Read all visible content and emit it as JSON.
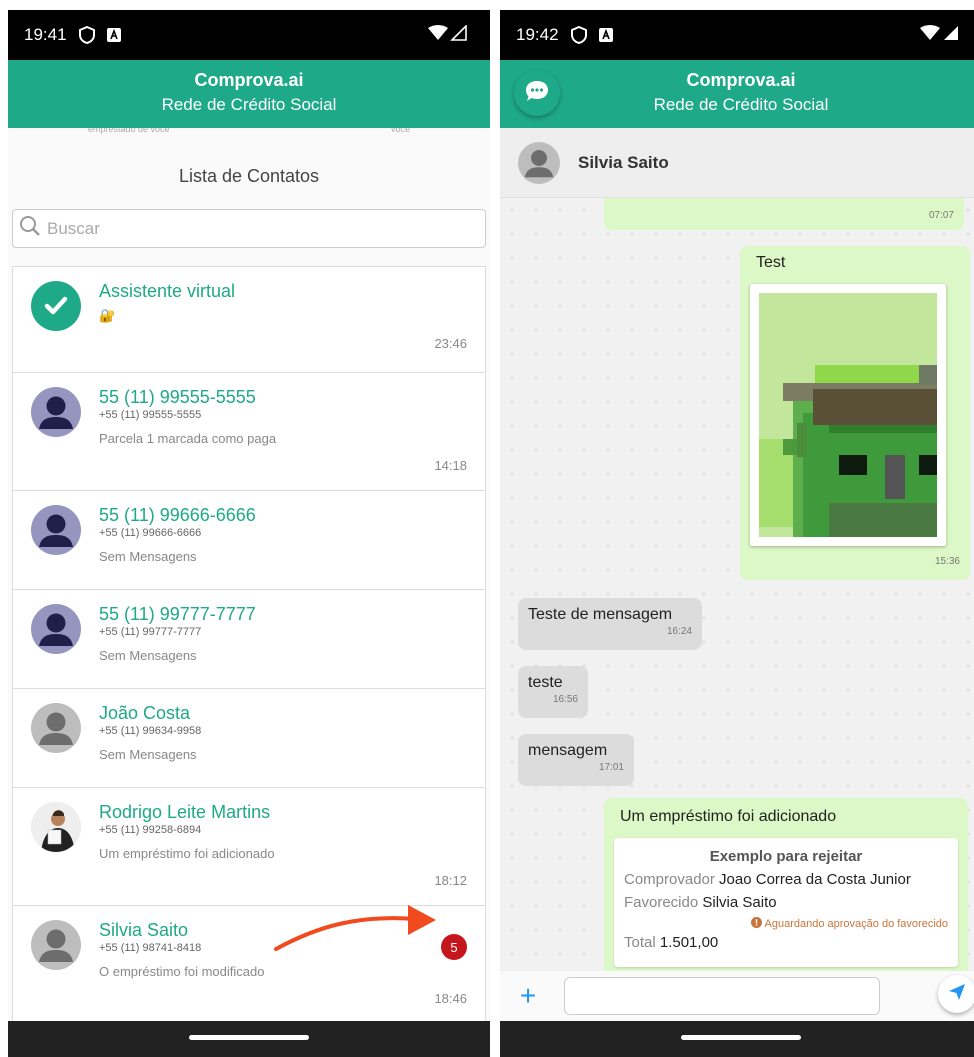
{
  "left": {
    "status": {
      "time": "19:41"
    },
    "header": {
      "title": "Comprova.ai",
      "subtitle": "Rede de Crédito Social"
    },
    "cut_text": {
      "a": "empréstado de você",
      "b": "você"
    },
    "list_title": "Lista de Contatos",
    "search": {
      "placeholder": "Buscar"
    },
    "contacts": [
      {
        "name": "Assistente virtual",
        "phone": "",
        "message": "🔐",
        "time": "23:46",
        "avatar": "check-icon"
      },
      {
        "name": "55 (11) 99555-5555",
        "phone": "+55 (11) 99555-5555",
        "message": "Parcela 1 marcada como paga",
        "time": "14:18",
        "avatar": "person-icon"
      },
      {
        "name": "55 (11) 99666-6666",
        "phone": "+55 (11) 99666-6666",
        "message": "Sem Mensagens",
        "time": "",
        "avatar": "person-icon"
      },
      {
        "name": "55 (11) 99777-7777",
        "phone": "+55 (11) 99777-7777",
        "message": "Sem Mensagens",
        "time": "",
        "avatar": "person-icon"
      },
      {
        "name": "João Costa",
        "phone": "+55 (11) 99634-9958",
        "message": "Sem Mensagens",
        "time": "",
        "avatar": "person-icon"
      },
      {
        "name": "Rodrigo Leite Martins",
        "phone": "+55 (11) 99258-6894",
        "message": "Um empréstimo foi adicionado",
        "time": "18:12",
        "avatar": "photo"
      },
      {
        "name": "Silvia Saito",
        "phone": "+55 (11) 98741-8418",
        "message": "O empréstimo foi modificado",
        "time": "18:46",
        "avatar": "person-icon",
        "badge": "5"
      }
    ]
  },
  "right": {
    "status": {
      "time": "19:42"
    },
    "header": {
      "title": "Comprova.ai",
      "subtitle": "Rede de Crédito Social"
    },
    "contact_name": "Silvia Saito",
    "messages": {
      "m1_time": "07:07",
      "m2_text": "Test",
      "m2_time": "15:36",
      "m3_text": "Teste de mensagem",
      "m3_time": "16:24",
      "m4_text": "teste",
      "m4_time": "16:56",
      "m5_text": "mensagem",
      "m5_time": "17:01",
      "m6_text": "Um empréstimo foi adicionado"
    },
    "loan": {
      "title": "Exemplo para rejeitar",
      "comprovador_label": "Comprovador",
      "comprovador_value": "Joao Correa da Costa Junior",
      "favorecido_label": "Favorecido",
      "favorecido_value": "Silvia Saito",
      "status": "Aguardando aprovação do favorecido",
      "total_label": "Total",
      "total_value": "1.501,00"
    },
    "input": {
      "plus": "+"
    }
  },
  "colors": {
    "brand": "#1ea988",
    "badge": "#c4161c",
    "outgoing": "#dcf8c6",
    "incoming": "#dcdcdc",
    "annotation_arrow": "#f04a1e"
  }
}
